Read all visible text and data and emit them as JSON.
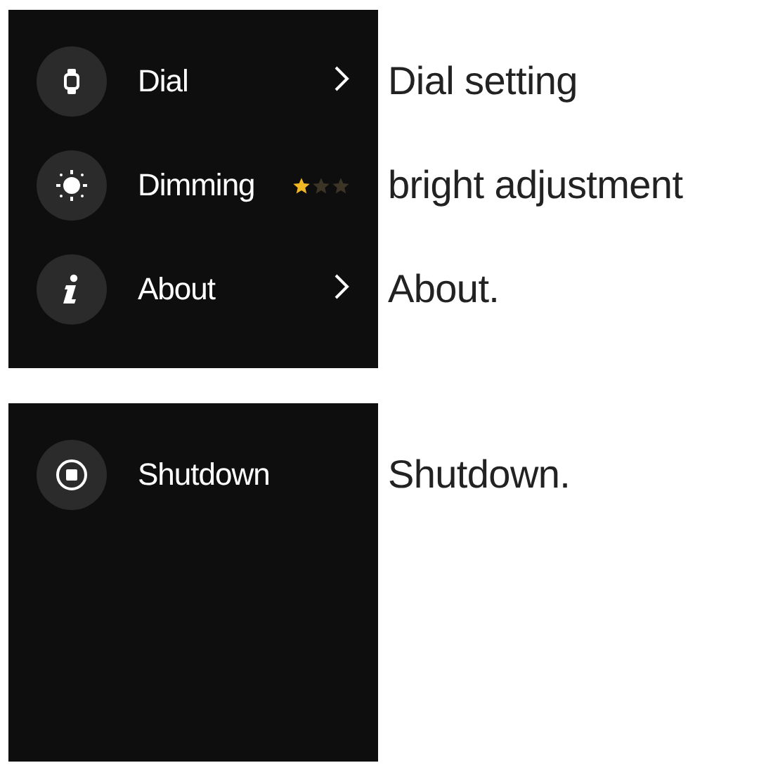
{
  "screens": [
    {
      "items": [
        {
          "kind": "link",
          "label": "Dial",
          "caption": "Dial setting"
        },
        {
          "kind": "stars",
          "label": "Dimming",
          "stars": 1,
          "caption": "bright adjustment"
        },
        {
          "kind": "link",
          "label": "About",
          "caption": "About."
        }
      ]
    },
    {
      "items": [
        {
          "kind": "action",
          "label": "Shutdown",
          "caption": "Shutdown."
        }
      ]
    }
  ]
}
